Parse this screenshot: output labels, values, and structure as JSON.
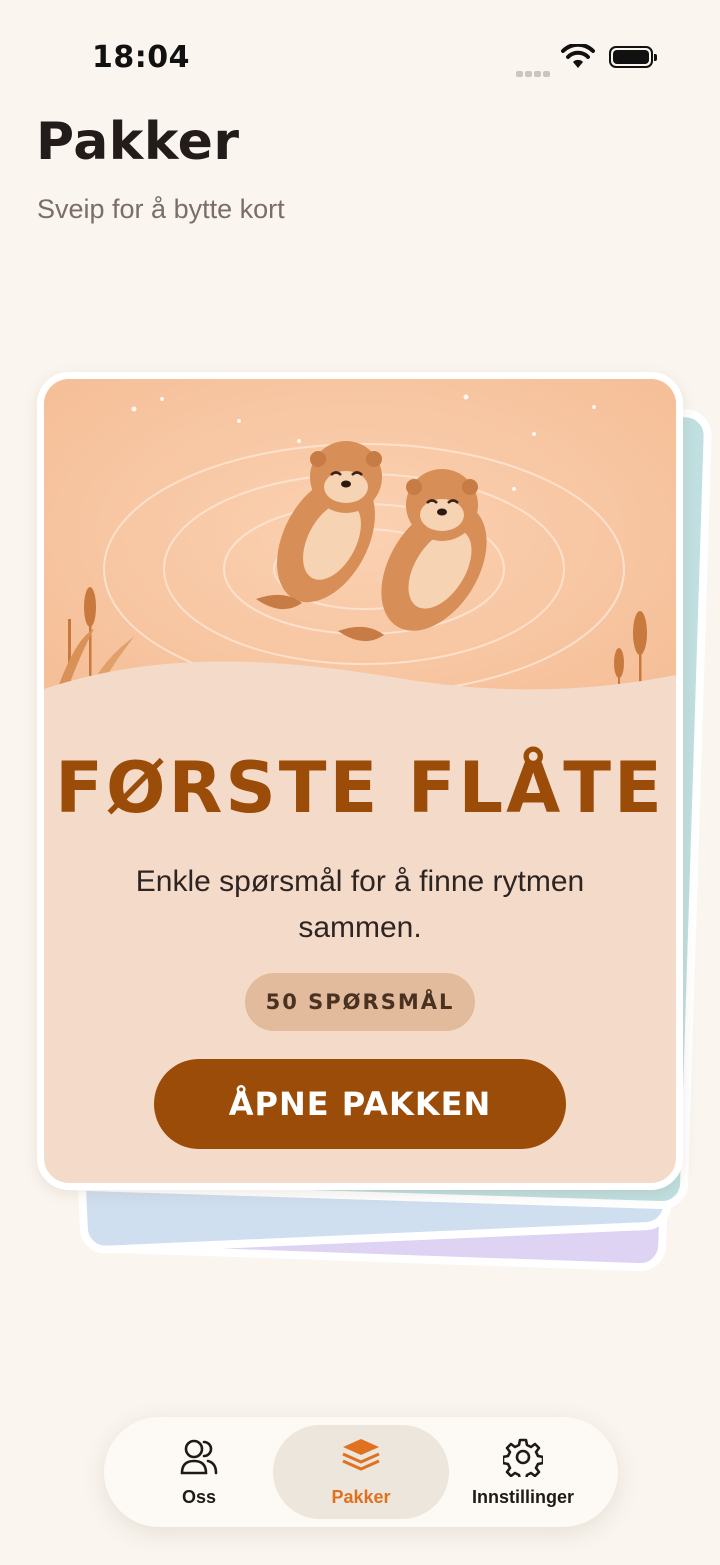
{
  "status_bar": {
    "time": "18:04"
  },
  "header": {
    "title": "Pakker",
    "subtitle": "Sveip for å bytte kort"
  },
  "card": {
    "title": "FØRSTE FLÅTE",
    "description": "Enkle spørsmål for å finne rytmen sammen.",
    "badge": "50 SPØRSMÅL",
    "button_label": "ÅPNE PAKKEN",
    "illustration": "two-otters-floating-icon"
  },
  "tabs": [
    {
      "label": "Oss",
      "icon": "people-icon",
      "active": false
    },
    {
      "label": "Pakker",
      "icon": "stack-icon",
      "active": true
    },
    {
      "label": "Innstillinger",
      "icon": "gear-icon",
      "active": false
    }
  ],
  "colors": {
    "background": "#faf5ef",
    "accent": "#9a4c08",
    "active_tab": "#e0711e",
    "card_bg": "#f4dbc9",
    "badge_bg": "#e2bb9c"
  }
}
